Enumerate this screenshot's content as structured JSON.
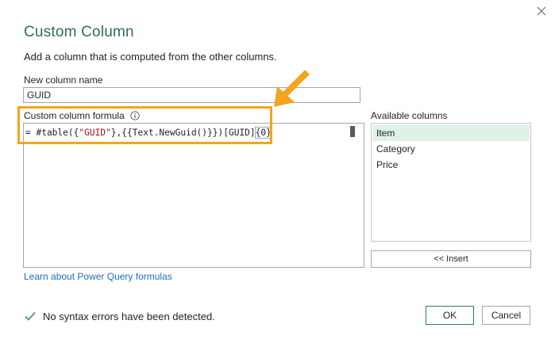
{
  "dialog": {
    "title": "Custom Column",
    "subtitle": "Add a column that is computed from the other columns."
  },
  "new_column": {
    "label": "New column name",
    "value": "GUID"
  },
  "formula": {
    "label": "Custom column formula",
    "prefix": "= #table({",
    "string_part": "\"GUID\"",
    "middle": "},{{Text.NewGuid()}})[GUID]",
    "bracket": "{0}"
  },
  "available_columns": {
    "label": "Available columns",
    "items": [
      "Item",
      "Category",
      "Price"
    ],
    "selected_index": 0,
    "insert_label": "<< Insert"
  },
  "learn_link": "Learn about Power Query formulas",
  "status": {
    "message": "No syntax errors have been detected.",
    "icon": "checkmark-icon"
  },
  "buttons": {
    "ok": "OK",
    "cancel": "Cancel"
  },
  "colors": {
    "title_green": "#2f6f4a",
    "highlight_orange": "#f2a51e",
    "selected_row": "#e0f2e5",
    "link_blue": "#1f6fb4",
    "check_green": "#4a9b67"
  }
}
